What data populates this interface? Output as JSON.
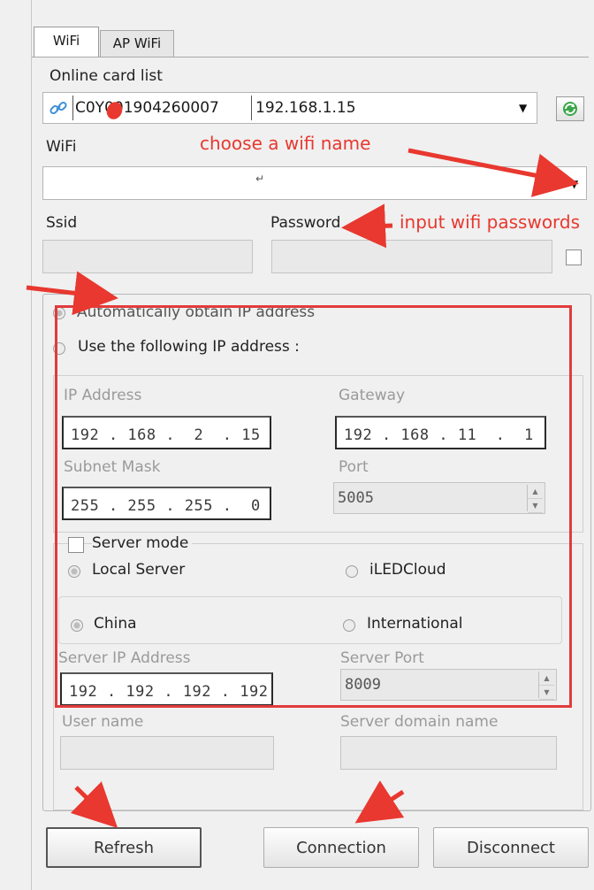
{
  "tabs": [
    {
      "label": "WiFi"
    },
    {
      "label": "AP WiFi"
    }
  ],
  "online_card": {
    "label": "Online card list",
    "card_id": "C0Y001904260007",
    "ip": "192.168.1.15"
  },
  "wifi": {
    "label": "WiFi",
    "value": "↵"
  },
  "ssid": {
    "label": "Ssid",
    "value": ""
  },
  "password": {
    "label": "Password",
    "value": ""
  },
  "ip_mode": {
    "auto_label": "Automatically obtain IP address",
    "manual_label": "Use the following IP address :"
  },
  "network": {
    "ip_label": "IP Address",
    "ip_value": "192 . 168 .  2  . 15",
    "gateway_label": "Gateway",
    "gateway_value": "192 . 168 . 11  .  1",
    "subnet_label": "Subnet Mask",
    "subnet_value": "255 . 255 . 255 .  0",
    "port_label": "Port",
    "port_value": "5005"
  },
  "server": {
    "mode_label": "Server mode",
    "local_label": "Local Server",
    "cloud_label": "iLEDCloud",
    "china_label": "China",
    "intl_label": "International",
    "server_ip_label": "Server IP Address",
    "server_ip_value": "192 . 192 . 192 . 192",
    "server_port_label": "Server Port",
    "server_port_value": "8009",
    "username_label": "User name",
    "domain_label": "Server domain name"
  },
  "buttons": {
    "refresh": "Refresh",
    "connection": "Connection",
    "disconnect": "Disconnect"
  },
  "annotations": {
    "choose_wifi": "choose a wifi name",
    "input_password": "input wifi passwords"
  },
  "colors": {
    "annotation": "#e8382f"
  }
}
